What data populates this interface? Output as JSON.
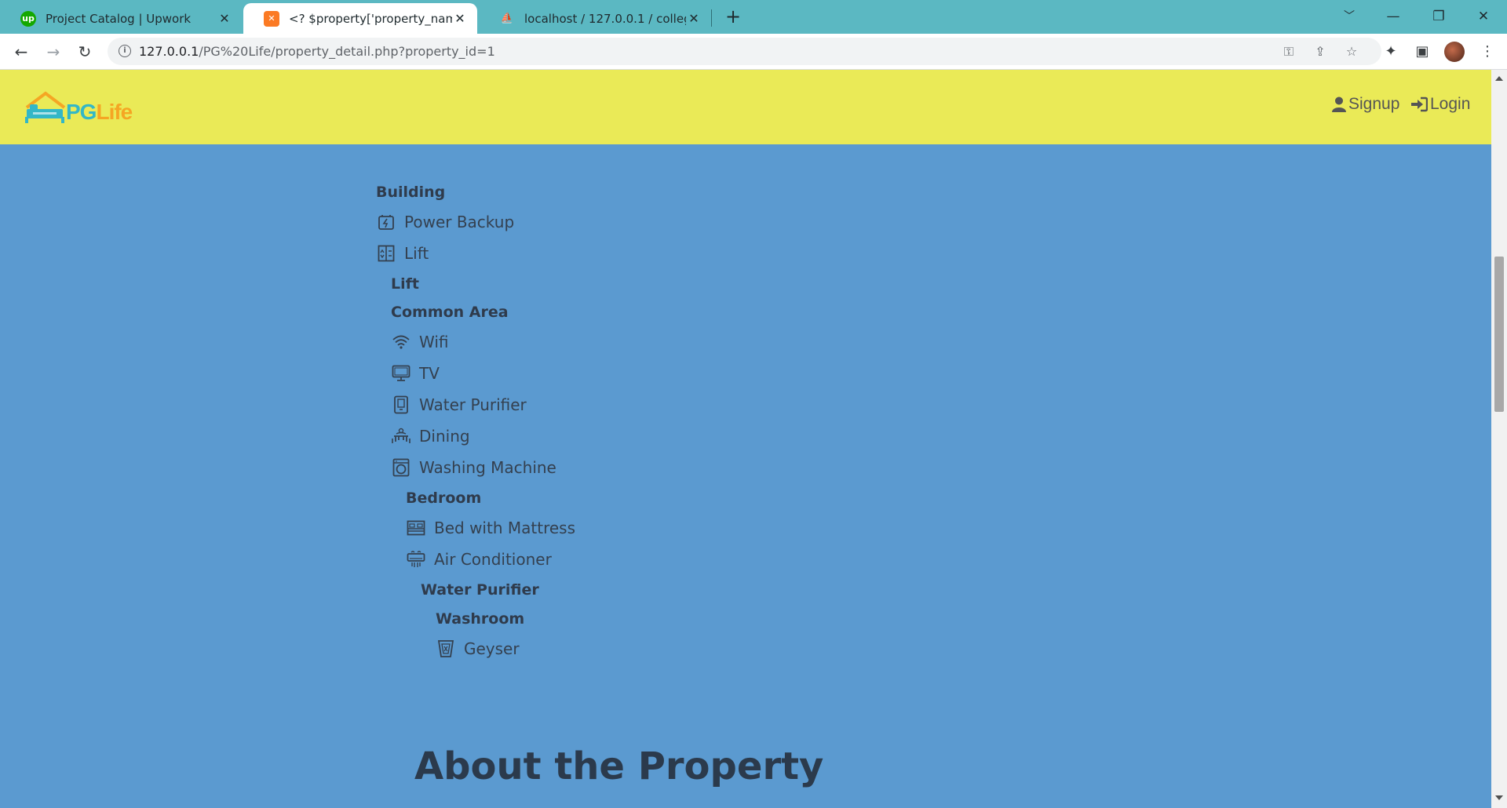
{
  "browser": {
    "tabs": [
      {
        "title": "Project Catalog | Upwork",
        "favicon": "upwork-icon",
        "active": false
      },
      {
        "title": "<? $property['property_name'] ?>",
        "favicon": "xampp-icon",
        "active": true
      },
      {
        "title": "localhost / 127.0.0.1 / college4 / ...",
        "favicon": "phpmyadmin-icon",
        "active": false
      }
    ],
    "new_tab": "+",
    "url_host": "127.0.0.1",
    "url_path": "/PG%20Life/property_detail.php?property_id=1"
  },
  "header": {
    "logo_pg": "PG",
    "logo_life": "Life",
    "signup": "Signup",
    "login": "Login"
  },
  "amenities": {
    "building": {
      "heading": "Building",
      "items": [
        {
          "label": "Power Backup",
          "icon": "power-backup-icon"
        },
        {
          "label": "Lift",
          "icon": "lift-icon"
        }
      ]
    },
    "lift_heading": "Lift",
    "common_area": {
      "heading": "Common Area",
      "items": [
        {
          "label": "Wifi",
          "icon": "wifi-icon"
        },
        {
          "label": "TV",
          "icon": "tv-icon"
        },
        {
          "label": "Water Purifier",
          "icon": "water-purifier-icon"
        },
        {
          "label": "Dining",
          "icon": "dining-icon"
        },
        {
          "label": "Washing Machine",
          "icon": "washing-machine-icon"
        }
      ]
    },
    "bedroom": {
      "heading": "Bedroom",
      "items": [
        {
          "label": "Bed with Mattress",
          "icon": "bed-icon"
        },
        {
          "label": "Air Conditioner",
          "icon": "air-conditioner-icon"
        }
      ]
    },
    "water_purifier_heading": "Water Purifier",
    "washroom": {
      "heading": "Washroom",
      "items": [
        {
          "label": "Geyser",
          "icon": "geyser-icon"
        }
      ]
    }
  },
  "about": {
    "heading": "About the Property"
  }
}
